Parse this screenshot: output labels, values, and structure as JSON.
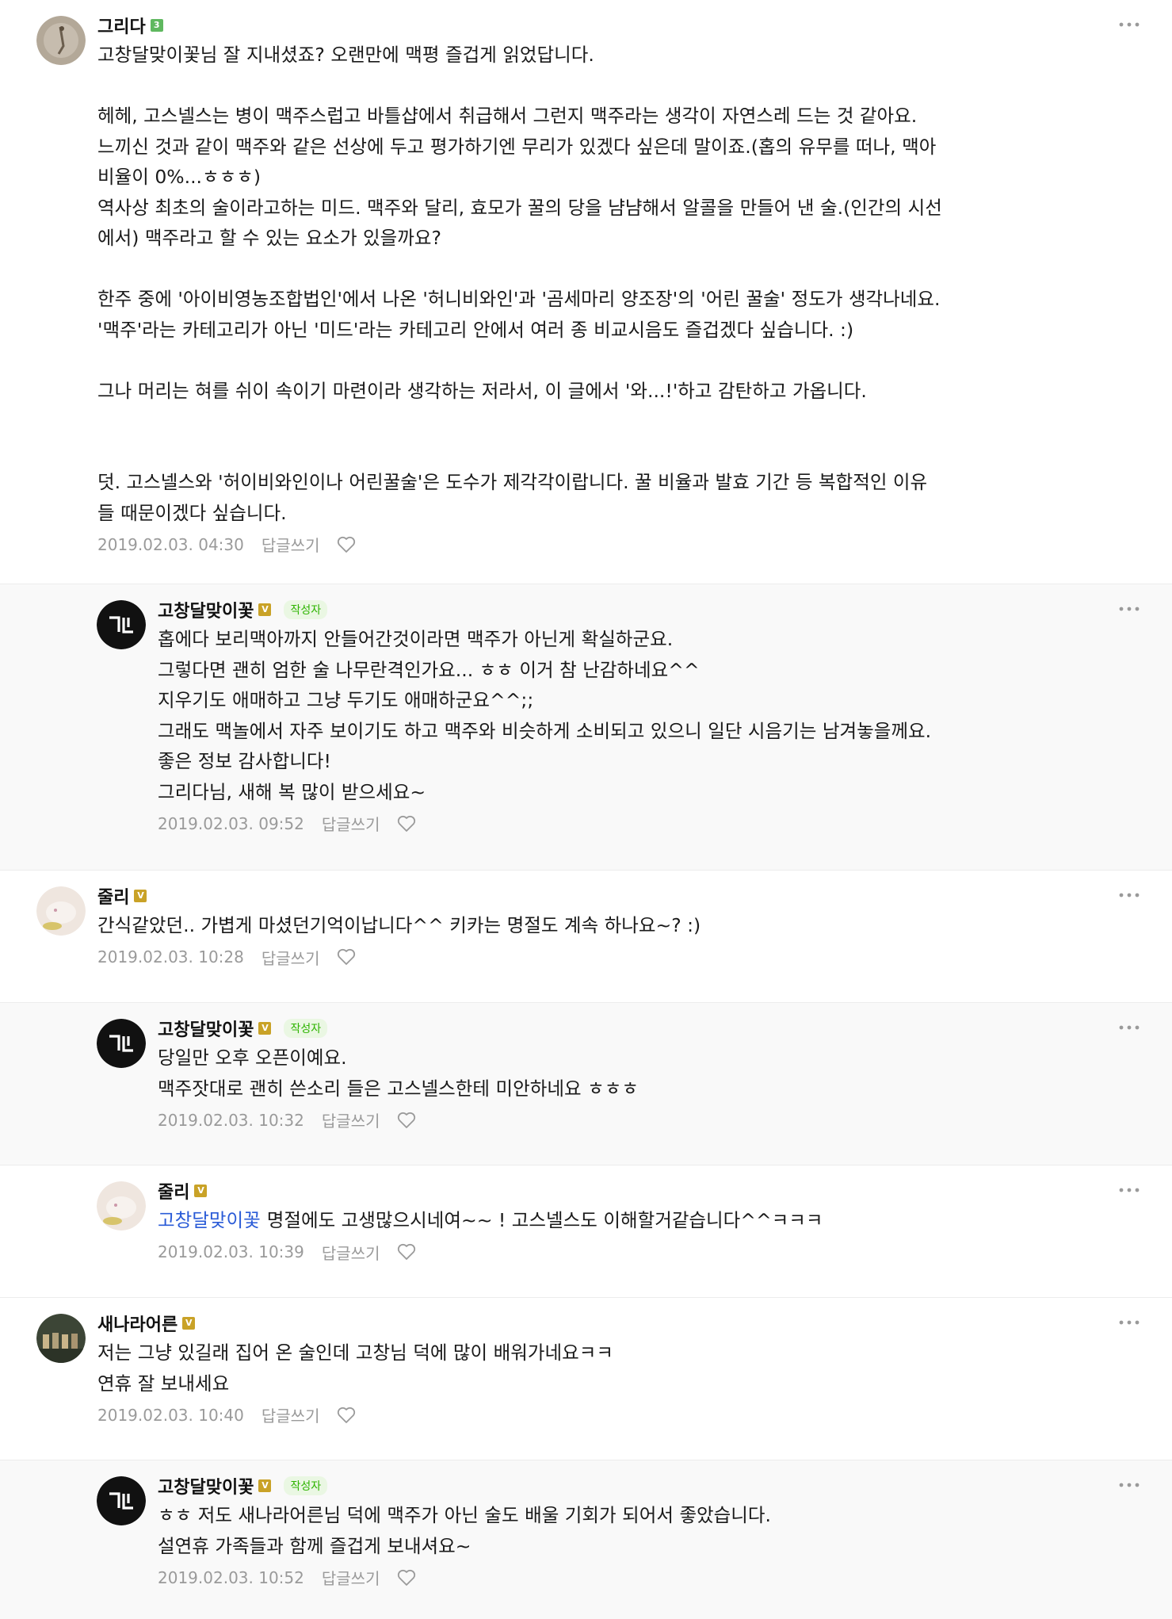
{
  "reply_label": "답글쓰기",
  "writer_tag": "작성자",
  "comments": [
    {
      "author": "그리다",
      "badge": "3",
      "date": "2019.02.03. 04:30",
      "lines": [
        "고창달맞이꽃님 잘 지내셨죠? 오랜만에 맥평 즐겁게 읽었답니다.",
        "",
        "헤헤, 고스넬스는 병이 맥주스럽고 바틀샵에서 취급해서 그런지 맥주라는 생각이 자연스레 드는 것 같아요.",
        "느끼신 것과 같이 맥주와 같은 선상에 두고 평가하기엔 무리가 있겠다 싶은데 말이죠.(홉의 유무를 떠나, 맥아",
        "비율이 0%...ㅎㅎㅎ)",
        "역사상 최초의 술이라고하는 미드. 맥주와 달리, 효모가 꿀의 당을 냠냠해서 알콜을 만들어 낸 술.(인간의 시선",
        "에서) 맥주라고 할 수 있는 요소가 있을까요?",
        "",
        "한주 중에 '아이비영농조합법인'에서 나온 '허니비와인'과 '곰세마리 양조장'의 '어린 꿀술' 정도가 생각나네요.",
        "'맥주'라는 카테고리가 아닌 '미드'라는 카테고리 안에서 여러 종 비교시음도 즐겁겠다 싶습니다. :)",
        "",
        "그나 머리는 혀를 쉬이 속이기 마련이라 생각하는 저라서, 이 글에서 '와...!'하고 감탄하고 가옵니다.",
        "",
        "",
        "덧. 고스넬스와 '허이비와인이나 어린꿀술'은 도수가 제각각이랍니다. 꿀 비율과 발효 기간 등 복합적인 이유",
        "들 때문이겠다 싶습니다."
      ]
    },
    {
      "author": "고창달맞이꽃",
      "badge": "V",
      "is_writer": true,
      "date": "2019.02.03. 09:52",
      "lines": [
        "홉에다 보리맥아까지 안들어간것이라면 맥주가 아닌게 확실하군요.",
        "그렇다면 괜히 엄한 술 나무란격인가요... ㅎㅎ 이거 참 난감하네요^^",
        "지우기도 애매하고 그냥 두기도 애매하군요^^;;",
        "그래도 맥놀에서 자주 보이기도 하고 맥주와 비슷하게 소비되고 있으니 일단 시음기는 남겨놓을께요.",
        "좋은 정보 감사합니다!",
        "그리다님, 새해 복 많이 받으세요~"
      ]
    },
    {
      "author": "줄리",
      "badge": "V",
      "date": "2019.02.03. 10:28",
      "lines": [
        "간식같았던.. 가볍게 마셨던기억이납니다^^ 키카는 명절도 계속 하나요~? :)"
      ]
    },
    {
      "author": "고창달맞이꽃",
      "badge": "V",
      "is_writer": true,
      "date": "2019.02.03. 10:32",
      "lines": [
        "당일만 오후 오픈이예요.",
        "맥주잣대로 괜히 쓴소리 들은 고스넬스한테 미안하네요 ㅎㅎㅎ"
      ]
    },
    {
      "author": "줄리",
      "badge": "V",
      "date": "2019.02.03. 10:39",
      "mention": "고창달맞이꽃",
      "lines": [
        "명절에도 고생많으시네여~~ ! 고스넬스도 이해할거같습니다^^ㅋㅋㅋ"
      ]
    },
    {
      "author": "새나라어른",
      "badge": "V",
      "date": "2019.02.03. 10:40",
      "lines": [
        "저는 그냥 있길래 집어 온 술인데 고창님 덕에 많이 배워가네요ㅋㅋ",
        "연휴 잘 보내세요"
      ]
    },
    {
      "author": "고창달맞이꽃",
      "badge": "V",
      "is_writer": true,
      "date": "2019.02.03. 10:52",
      "lines": [
        "ㅎㅎ 저도 새나라어른님 덕에 맥주가 아닌 술도 배울 기회가 되어서 좋았습니다.",
        "설연휴 가족들과 함께 즐겁게 보내셔요~"
      ]
    }
  ]
}
